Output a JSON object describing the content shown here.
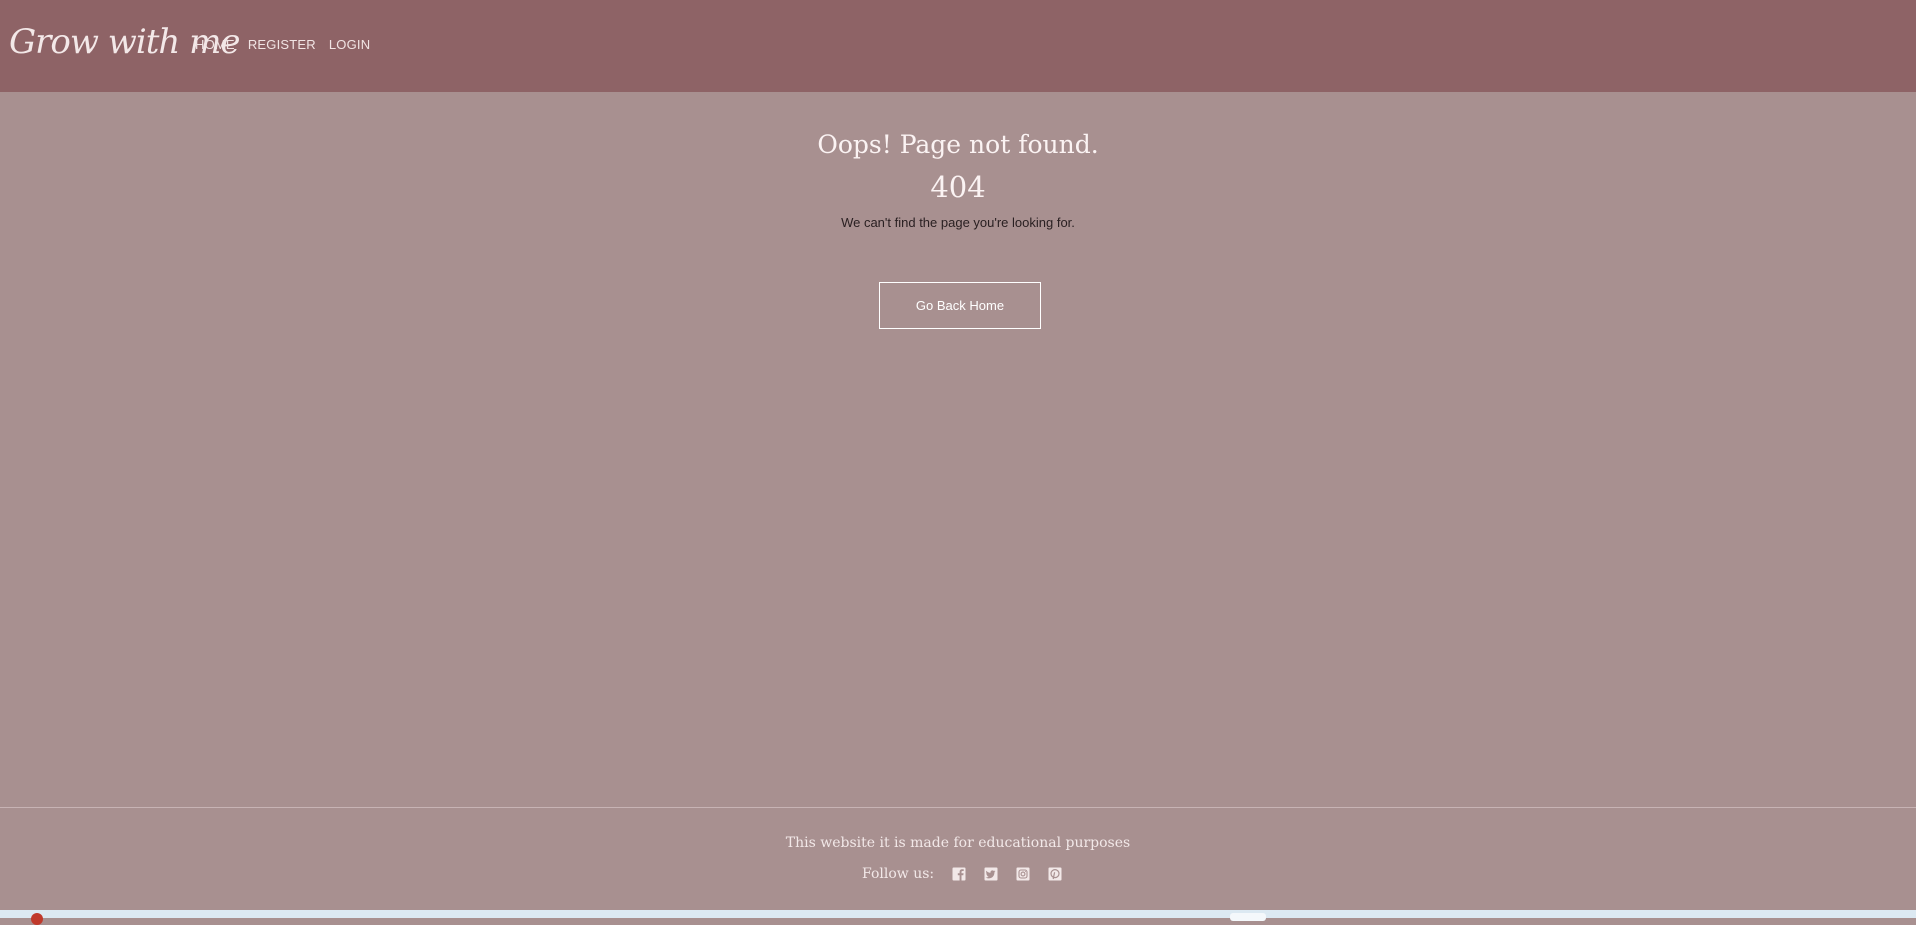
{
  "header": {
    "logo": "Grow with me",
    "nav": [
      {
        "label": "HOME"
      },
      {
        "label": "REGISTER"
      },
      {
        "label": "LOGIN"
      }
    ]
  },
  "main": {
    "title": "Oops! Page not found.",
    "code": "404",
    "description": "We can't find the page you're looking for.",
    "button_label": "Go Back Home"
  },
  "footer": {
    "note": "This website it is made for educational purposes",
    "follow_label": "Follow us:",
    "social_icons": [
      "facebook-icon",
      "twitter-icon",
      "instagram-icon",
      "pinterest-icon"
    ]
  },
  "colors": {
    "header_bg": "#8e6366",
    "page_bg": "#a89090",
    "text_light": "#fbf3f3"
  }
}
